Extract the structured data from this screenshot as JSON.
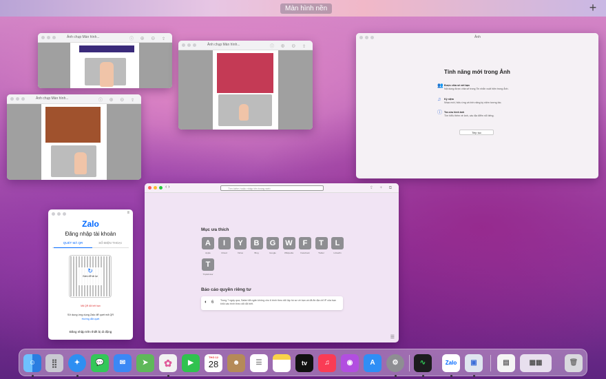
{
  "desktop": {
    "label": "Màn hình nền",
    "add_label": "+"
  },
  "windows": {
    "preview1": {
      "title": "Ảnh chụp Màn hình..."
    },
    "preview2": {
      "title": "Ảnh chụp Màn hình..."
    },
    "preview3": {
      "title": "Ảnh chụp Màn hình..."
    },
    "photos": {
      "app_title": "Ảnh",
      "heading": "Tính năng mới trong Ảnh",
      "features": [
        {
          "title": "Được chia sẻ với bạn",
          "desc": "Nội dung được chia sẻ trong Tin nhắn xuất hiện trong Ảnh.",
          "icon": "people-icon"
        },
        {
          "title": "Kỷ niệm",
          "desc": "Nhạc mới, hiệu ứng và tính năng kỷ niệm tương tác.",
          "icon": "music-icon"
        },
        {
          "title": "Tra cứu hình ảnh",
          "desc": "Tìm hiểu thêm về ảnh, các địa điểm nổi tiếng.",
          "icon": "info-icon"
        }
      ],
      "continue_label": "Tiếp tục"
    },
    "safari": {
      "address_placeholder": "Tìm kiếm hoặc nhập tên trang web",
      "favorites_title": "Mục ưa thích",
      "favorites": [
        {
          "letter": "A",
          "label": "Apple"
        },
        {
          "letter": "I",
          "label": "iCloud"
        },
        {
          "letter": "Y",
          "label": "Yahoo"
        },
        {
          "letter": "B",
          "label": "Bing"
        },
        {
          "letter": "G",
          "label": "Google"
        },
        {
          "letter": "W",
          "label": "Wikipedia"
        },
        {
          "letter": "F",
          "label": "Facebook"
        },
        {
          "letter": "T",
          "label": "Twitter"
        },
        {
          "letter": "L",
          "label": "LinkedIn"
        },
        {
          "letter": "T",
          "label": "TripAdvisor"
        }
      ],
      "privacy_title": "Báo cáo quyền riêng tư",
      "privacy_count": "6",
      "privacy_text": "Trong 7 ngày qua, Safari đã ngăn không cho 6 trình theo dõi lập hồ sơ về bạn và đã ẩn địa chỉ IP của bạn khỏi các trình theo dõi đã biết."
    },
    "zalo": {
      "logo": "Zalo",
      "heading": "Đăng nhập tài khoản",
      "tab_qr": "QUÉT MÃ QR",
      "tab_phone": "SỐ ĐIỆN THOẠI",
      "qr_overlay": "Bấm để tải lại",
      "expired": "Mã QR đã hết hạn",
      "instruction": "Sử dụng ứng dụng Zalo để quét mã QR",
      "guide_link": "Hướng dẫn quét",
      "footer": "Đăng nhập trên thiết bị di động"
    }
  },
  "dock": {
    "calendar_month": "THG 12",
    "calendar_day": "28",
    "tv_label": "tv",
    "apps": [
      {
        "name": "finder-icon",
        "color": "#3b8ee8"
      },
      {
        "name": "launchpad-icon",
        "color": "#c7c7d0"
      },
      {
        "name": "safari-icon",
        "color": "#2e8ff2"
      },
      {
        "name": "messages-icon",
        "color": "#34c759"
      },
      {
        "name": "mail-icon",
        "color": "#3b88f5"
      },
      {
        "name": "maps-icon",
        "color": "#5fb85a"
      },
      {
        "name": "photos-icon",
        "color": "#f2f2f2"
      },
      {
        "name": "facetime-icon",
        "color": "#30c24f"
      },
      {
        "name": "calendar-icon",
        "color": "#ffffff"
      },
      {
        "name": "contacts-icon",
        "color": "#b58a58"
      },
      {
        "name": "reminders-icon",
        "color": "#ffffff"
      },
      {
        "name": "notes-icon",
        "color": "#f9d24a"
      },
      {
        "name": "apple-tv-icon",
        "color": "#111111"
      },
      {
        "name": "music-icon",
        "color": "#fa3c55"
      },
      {
        "name": "podcasts-icon",
        "color": "#b24ee0"
      },
      {
        "name": "app-store-icon",
        "color": "#2f8ef5"
      },
      {
        "name": "system-preferences-icon",
        "color": "#8e8e93"
      },
      {
        "name": "activity-monitor-icon",
        "color": "#1c1c1e"
      },
      {
        "name": "zalo-icon",
        "color": "#ffffff"
      },
      {
        "name": "preview-icon",
        "color": "#dfe6f0"
      },
      {
        "name": "document-icon",
        "color": "#f5f5f5"
      },
      {
        "name": "screenshots-stack-icon",
        "color": "#e8e0ee"
      },
      {
        "name": "trash-icon",
        "color": "#d9d9de"
      }
    ]
  }
}
